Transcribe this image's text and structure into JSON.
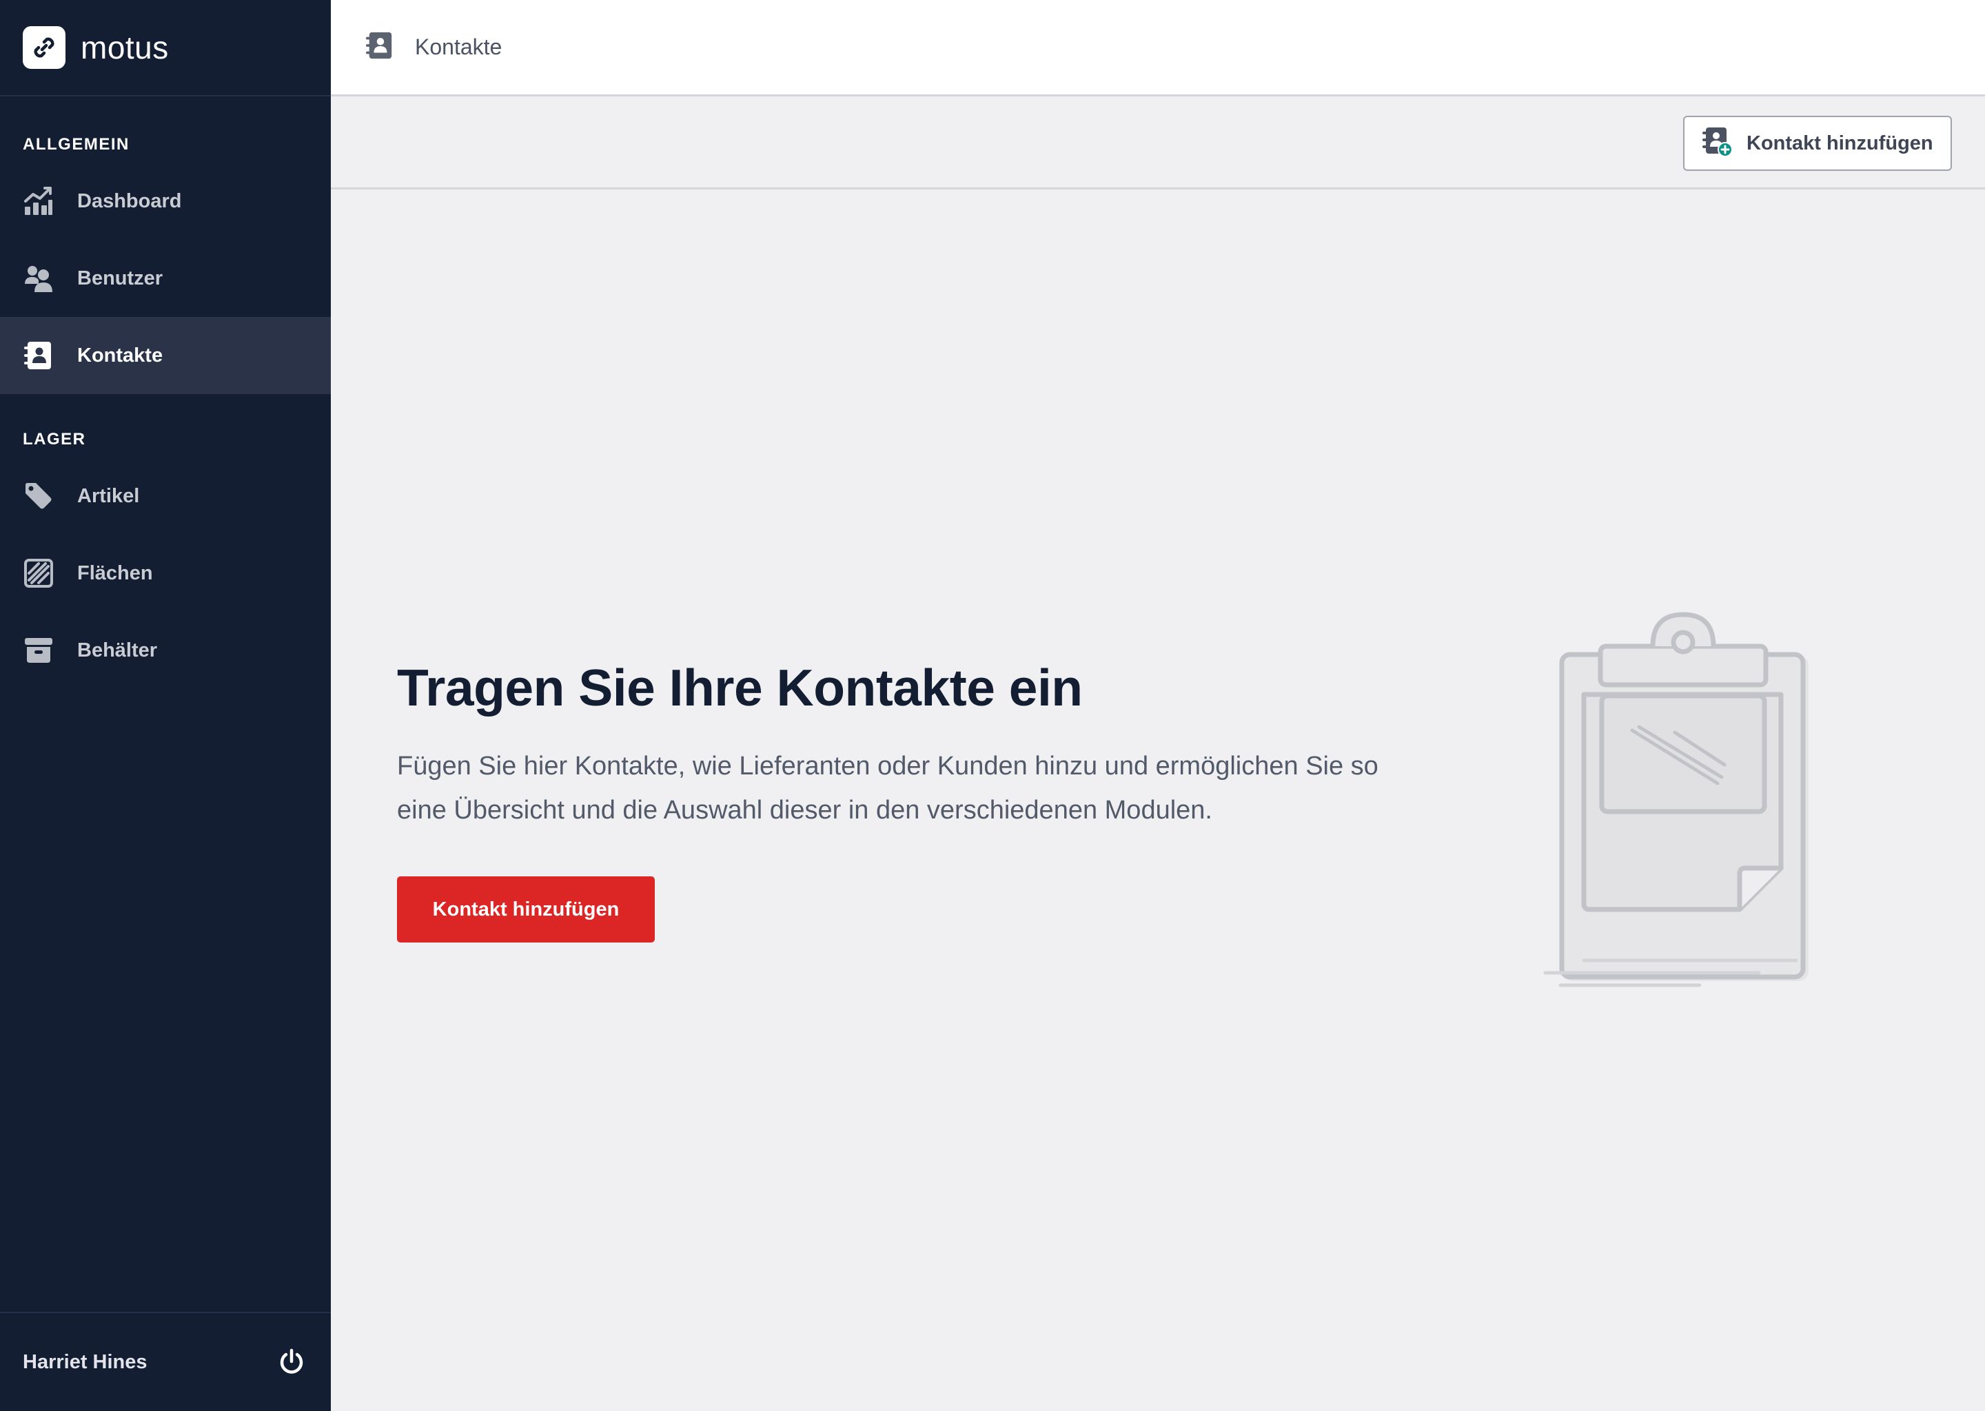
{
  "app": {
    "name": "motus"
  },
  "sidebar": {
    "sections": [
      {
        "heading": "ALLGEMEIN",
        "items": [
          {
            "label": "Dashboard",
            "icon": "chart-icon",
            "active": false
          },
          {
            "label": "Benutzer",
            "icon": "users-icon",
            "active": false
          },
          {
            "label": "Kontakte",
            "icon": "address-book-icon",
            "active": true
          }
        ]
      },
      {
        "heading": "LAGER",
        "items": [
          {
            "label": "Artikel",
            "icon": "tags-icon",
            "active": false
          },
          {
            "label": "Flächen",
            "icon": "hatched-square-icon",
            "active": false
          },
          {
            "label": "Behälter",
            "icon": "box-icon",
            "active": false
          }
        ]
      }
    ],
    "user": {
      "name": "Harriet Hines"
    }
  },
  "header": {
    "title": "Kontakte",
    "icon": "address-book-icon"
  },
  "toolbar": {
    "add_button_label": "Kontakt hinzufügen",
    "add_button_icon": "add-contact-icon"
  },
  "empty_state": {
    "title": "Tragen Sie Ihre Kontakte ein",
    "text": "Fügen Sie hier Kontakte, wie Lieferanten oder Kunden hinzu und ermöglichen Sie so eine Übersicht und die Auswahl dieser in den verschiedenen Modulen.",
    "button_label": "Kontakt hinzufügen",
    "illustration": "clipboard-illustration"
  },
  "colors": {
    "sidebar_bg": "#141e33",
    "sidebar_active": "#2a3347",
    "content_bg": "#f0f0f2",
    "primary": "#dc2626",
    "title": "#141e33",
    "accent_teal": "#0d8f8a"
  }
}
